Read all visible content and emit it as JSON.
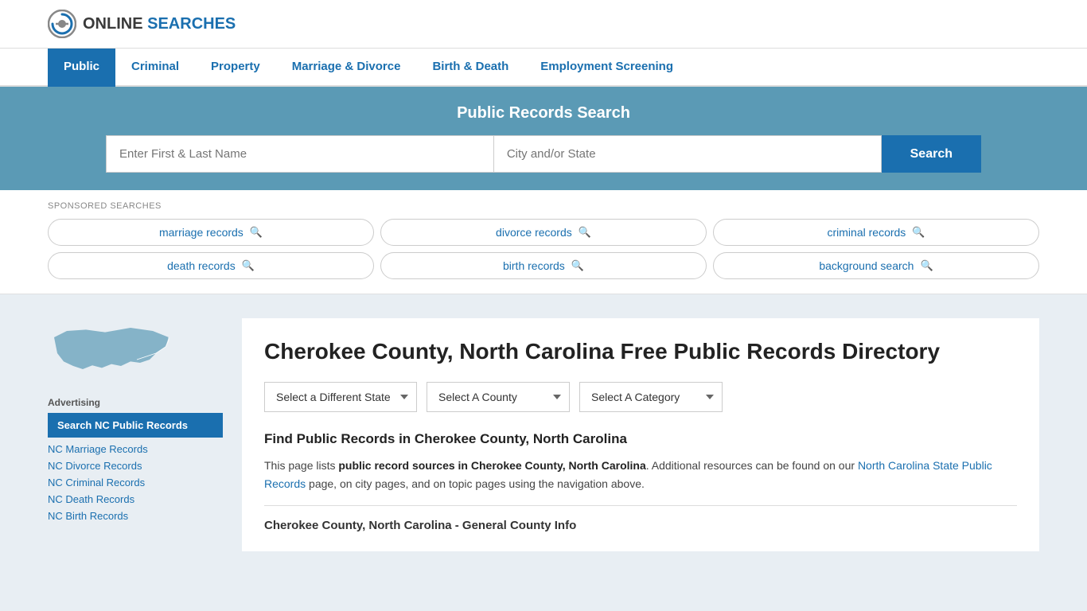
{
  "logo": {
    "text_online": "ONLINE",
    "text_searches": "SEARCHES"
  },
  "nav": {
    "items": [
      {
        "label": "Public",
        "active": true
      },
      {
        "label": "Criminal",
        "active": false
      },
      {
        "label": "Property",
        "active": false
      },
      {
        "label": "Marriage & Divorce",
        "active": false
      },
      {
        "label": "Birth & Death",
        "active": false
      },
      {
        "label": "Employment Screening",
        "active": false
      }
    ]
  },
  "search_banner": {
    "title": "Public Records Search",
    "name_placeholder": "Enter First & Last Name",
    "city_placeholder": "City and/or State",
    "button_label": "Search"
  },
  "sponsored": {
    "label": "SPONSORED SEARCHES",
    "items": [
      {
        "label": "marriage records"
      },
      {
        "label": "divorce records"
      },
      {
        "label": "criminal records"
      },
      {
        "label": "death records"
      },
      {
        "label": "birth records"
      },
      {
        "label": "background search"
      }
    ]
  },
  "sidebar": {
    "advertising_label": "Advertising",
    "ad_active_label": "Search NC Public Records",
    "links": [
      {
        "label": "NC Marriage Records"
      },
      {
        "label": "NC Divorce Records"
      },
      {
        "label": "NC Criminal Records"
      },
      {
        "label": "NC Death Records"
      },
      {
        "label": "NC Birth Records"
      }
    ]
  },
  "content": {
    "page_title": "Cherokee County, North Carolina Free Public Records Directory",
    "dropdowns": {
      "state": "Select a Different State",
      "county": "Select A County",
      "category": "Select A Category"
    },
    "find_title": "Find Public Records in Cherokee County, North Carolina",
    "description_part1": "This page lists ",
    "description_bold": "public record sources in Cherokee County, North Carolina",
    "description_part2": ". Additional resources can be found on our ",
    "description_link": "North Carolina State Public Records",
    "description_part3": " page, on city pages, and on topic pages using the navigation above.",
    "county_info_title": "Cherokee County, North Carolina - General County Info"
  }
}
